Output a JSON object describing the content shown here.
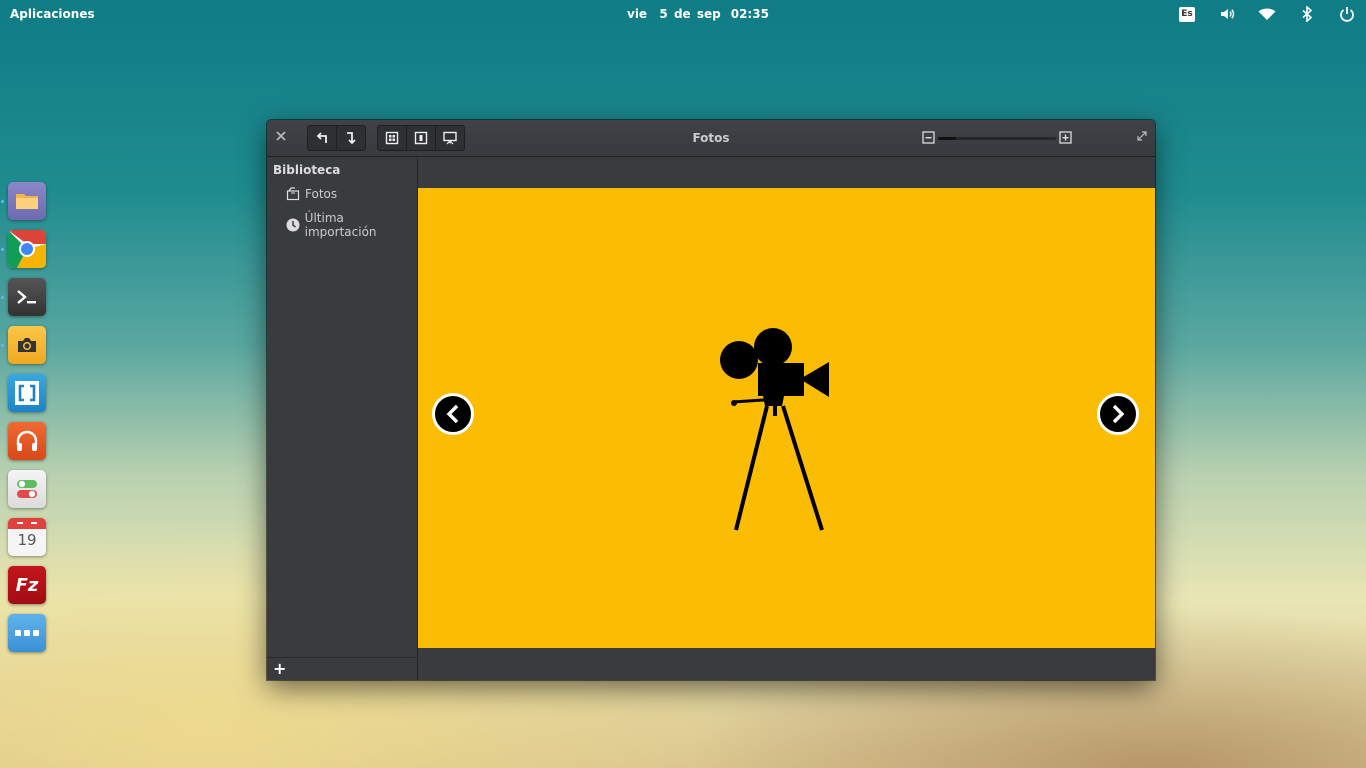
{
  "panel": {
    "applications_label": "Aplicaciones",
    "clock_date": "vie  5 de sep",
    "clock_time": "02:35",
    "keyboard_layout": "Es"
  },
  "dock": {
    "items": [
      {
        "name": "files",
        "icon": "folder-icon",
        "running": true
      },
      {
        "name": "chrome",
        "icon": "chrome-icon",
        "running": true
      },
      {
        "name": "terminal",
        "icon": "terminal-icon",
        "running": true
      },
      {
        "name": "camera",
        "icon": "camera-icon",
        "running": true
      },
      {
        "name": "brackets",
        "icon": "brackets-icon",
        "running": false
      },
      {
        "name": "music",
        "icon": "headphones-icon",
        "running": false
      },
      {
        "name": "settings",
        "icon": "toggles-icon",
        "running": false
      },
      {
        "name": "calendar",
        "icon": "calendar-icon",
        "running": false,
        "day": "19"
      },
      {
        "name": "filezilla",
        "icon": "filezilla-icon",
        "running": false,
        "label": "Fz"
      },
      {
        "name": "more",
        "icon": "more-icon",
        "running": false
      }
    ]
  },
  "window": {
    "title": "Fotos",
    "zoom_level": 0.15,
    "colors": {
      "photo_background": "#fbbc04"
    }
  },
  "sidebar": {
    "header": "Biblioteca",
    "items": [
      {
        "label": "Fotos",
        "icon": "photos-icon"
      },
      {
        "label": "Última importación",
        "icon": "clock-icon"
      }
    ]
  }
}
